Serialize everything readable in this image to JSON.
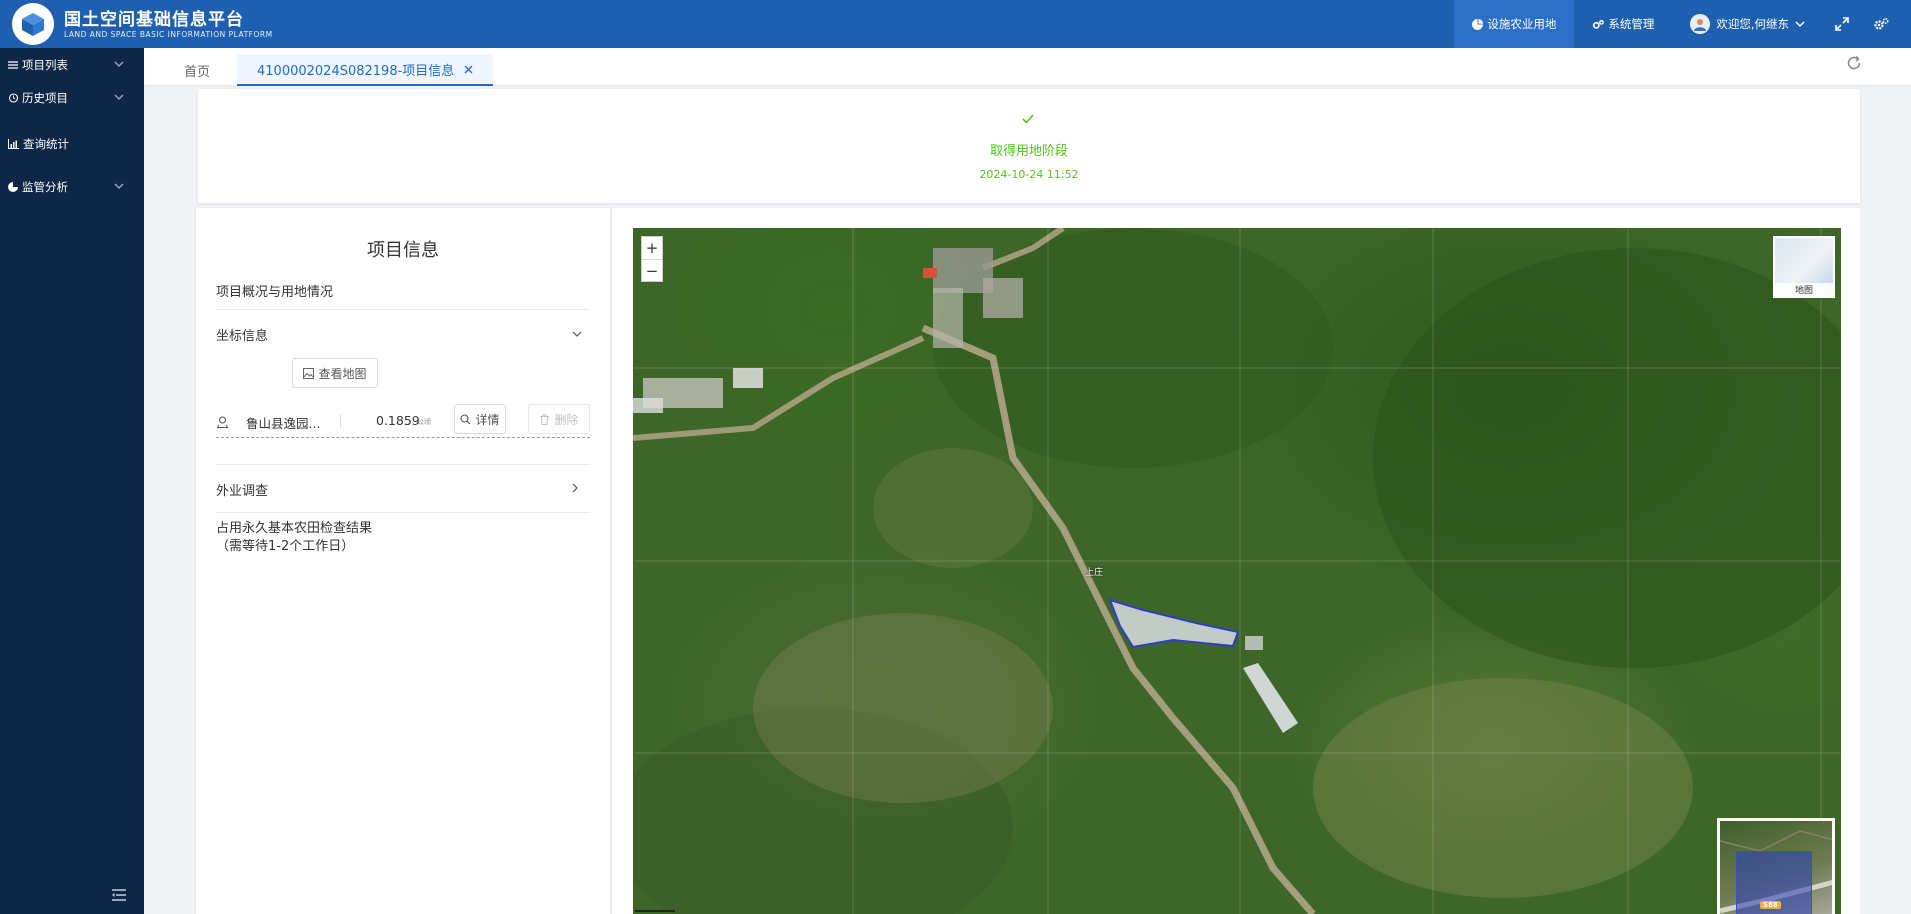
{
  "header": {
    "title_cn": "国土空间基础信息平台",
    "title_en": "LAND AND SPACE BASIC INFORMATION PLATFORM",
    "nav": [
      {
        "label": "设施农业用地",
        "icon": "pie-chart-icon",
        "active": true
      },
      {
        "label": "系统管理",
        "icon": "cogs-icon",
        "active": false
      }
    ],
    "user_greeting": "欢迎您,何继东",
    "colors": {
      "header_bg": "#1f5fb0",
      "active_nav": "#2c6fc6",
      "sidebar_bg": "#0f2746",
      "accent": "#1f6ac8",
      "success": "#52c41a"
    }
  },
  "sidebar": {
    "items": [
      {
        "label": "项目列表",
        "icon": "list-icon",
        "has_children": true
      },
      {
        "label": "历史项目",
        "icon": "history-icon",
        "has_children": true
      },
      {
        "label": "查询统计",
        "icon": "bar-chart-icon",
        "has_children": false
      },
      {
        "label": "监管分析",
        "icon": "pie-chart-icon",
        "has_children": true
      }
    ]
  },
  "tabs": {
    "home": "首页",
    "active": "4100002024S082198-项目信息"
  },
  "status": {
    "stage": "取得用地阶段",
    "time": "2024-10-24 11:52"
  },
  "project": {
    "title": "项目信息",
    "overview": "项目概况与用地情况",
    "coord_section": "坐标信息",
    "view_map": "查看地图",
    "coord_row": {
      "name": "鲁山县逸园...",
      "area": "0.1859",
      "unit": "公顷",
      "detail": "详情",
      "delete": "删除"
    },
    "field_survey": "外业调查",
    "farmland_check": "占用永久基本农田检查结果",
    "farmland_note": "（需等待1-2个工作日）"
  },
  "map": {
    "zoom_in": "+",
    "zoom_out": "−",
    "layer_label": "地图",
    "place_label": "上庄",
    "highway_label": "S88"
  }
}
